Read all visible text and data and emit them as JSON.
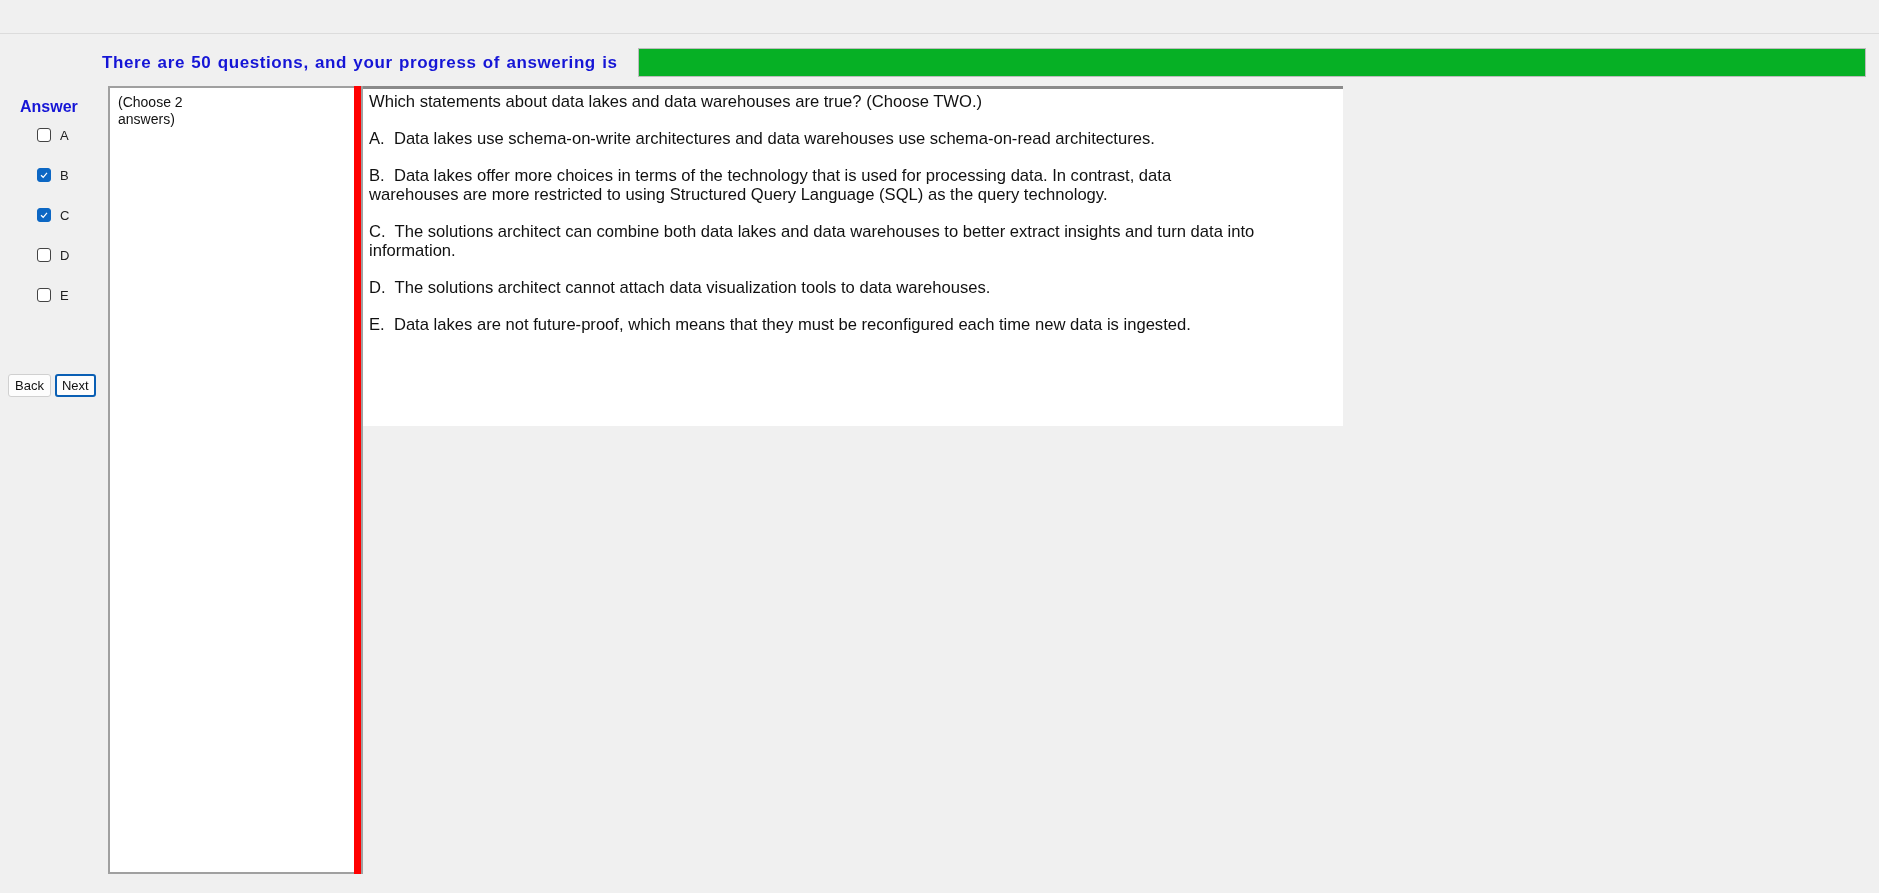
{
  "progress": {
    "label": "There are 50 questions, and your progress of answering is",
    "level": 1
  },
  "answer": {
    "title": "Answer",
    "options": [
      {
        "label": "A",
        "checked": false
      },
      {
        "label": "B",
        "checked": true
      },
      {
        "label": "C",
        "checked": true
      },
      {
        "label": "D",
        "checked": false
      },
      {
        "label": "E",
        "checked": false
      }
    ]
  },
  "buttons": [
    {
      "label": "Back",
      "focused": false
    },
    {
      "label": "Next",
      "focused": true
    }
  ],
  "hint": "(Choose 2 answers)",
  "question": {
    "paragraphs": [
      "Which statements about data lakes and data warehouses are true? (Choose TWO.)",
      "A.  Data lakes use schema-on-write architectures and data warehouses use schema-on-read architectures.",
      "B.  Data lakes offer more choices in terms of the technology that is used for processing data. In contrast, data warehouses are more restricted to using Structured Query Language (SQL) as the query technology.",
      "C.  The solutions architect can combine both data lakes and data warehouses to better extract insights and turn data into information.",
      "D.  The solutions architect cannot attach data visualization tools to data warehouses.",
      "E.  Data lakes are not future-proof, which means that they must be reconfigured each time new data is ingested."
    ]
  }
}
